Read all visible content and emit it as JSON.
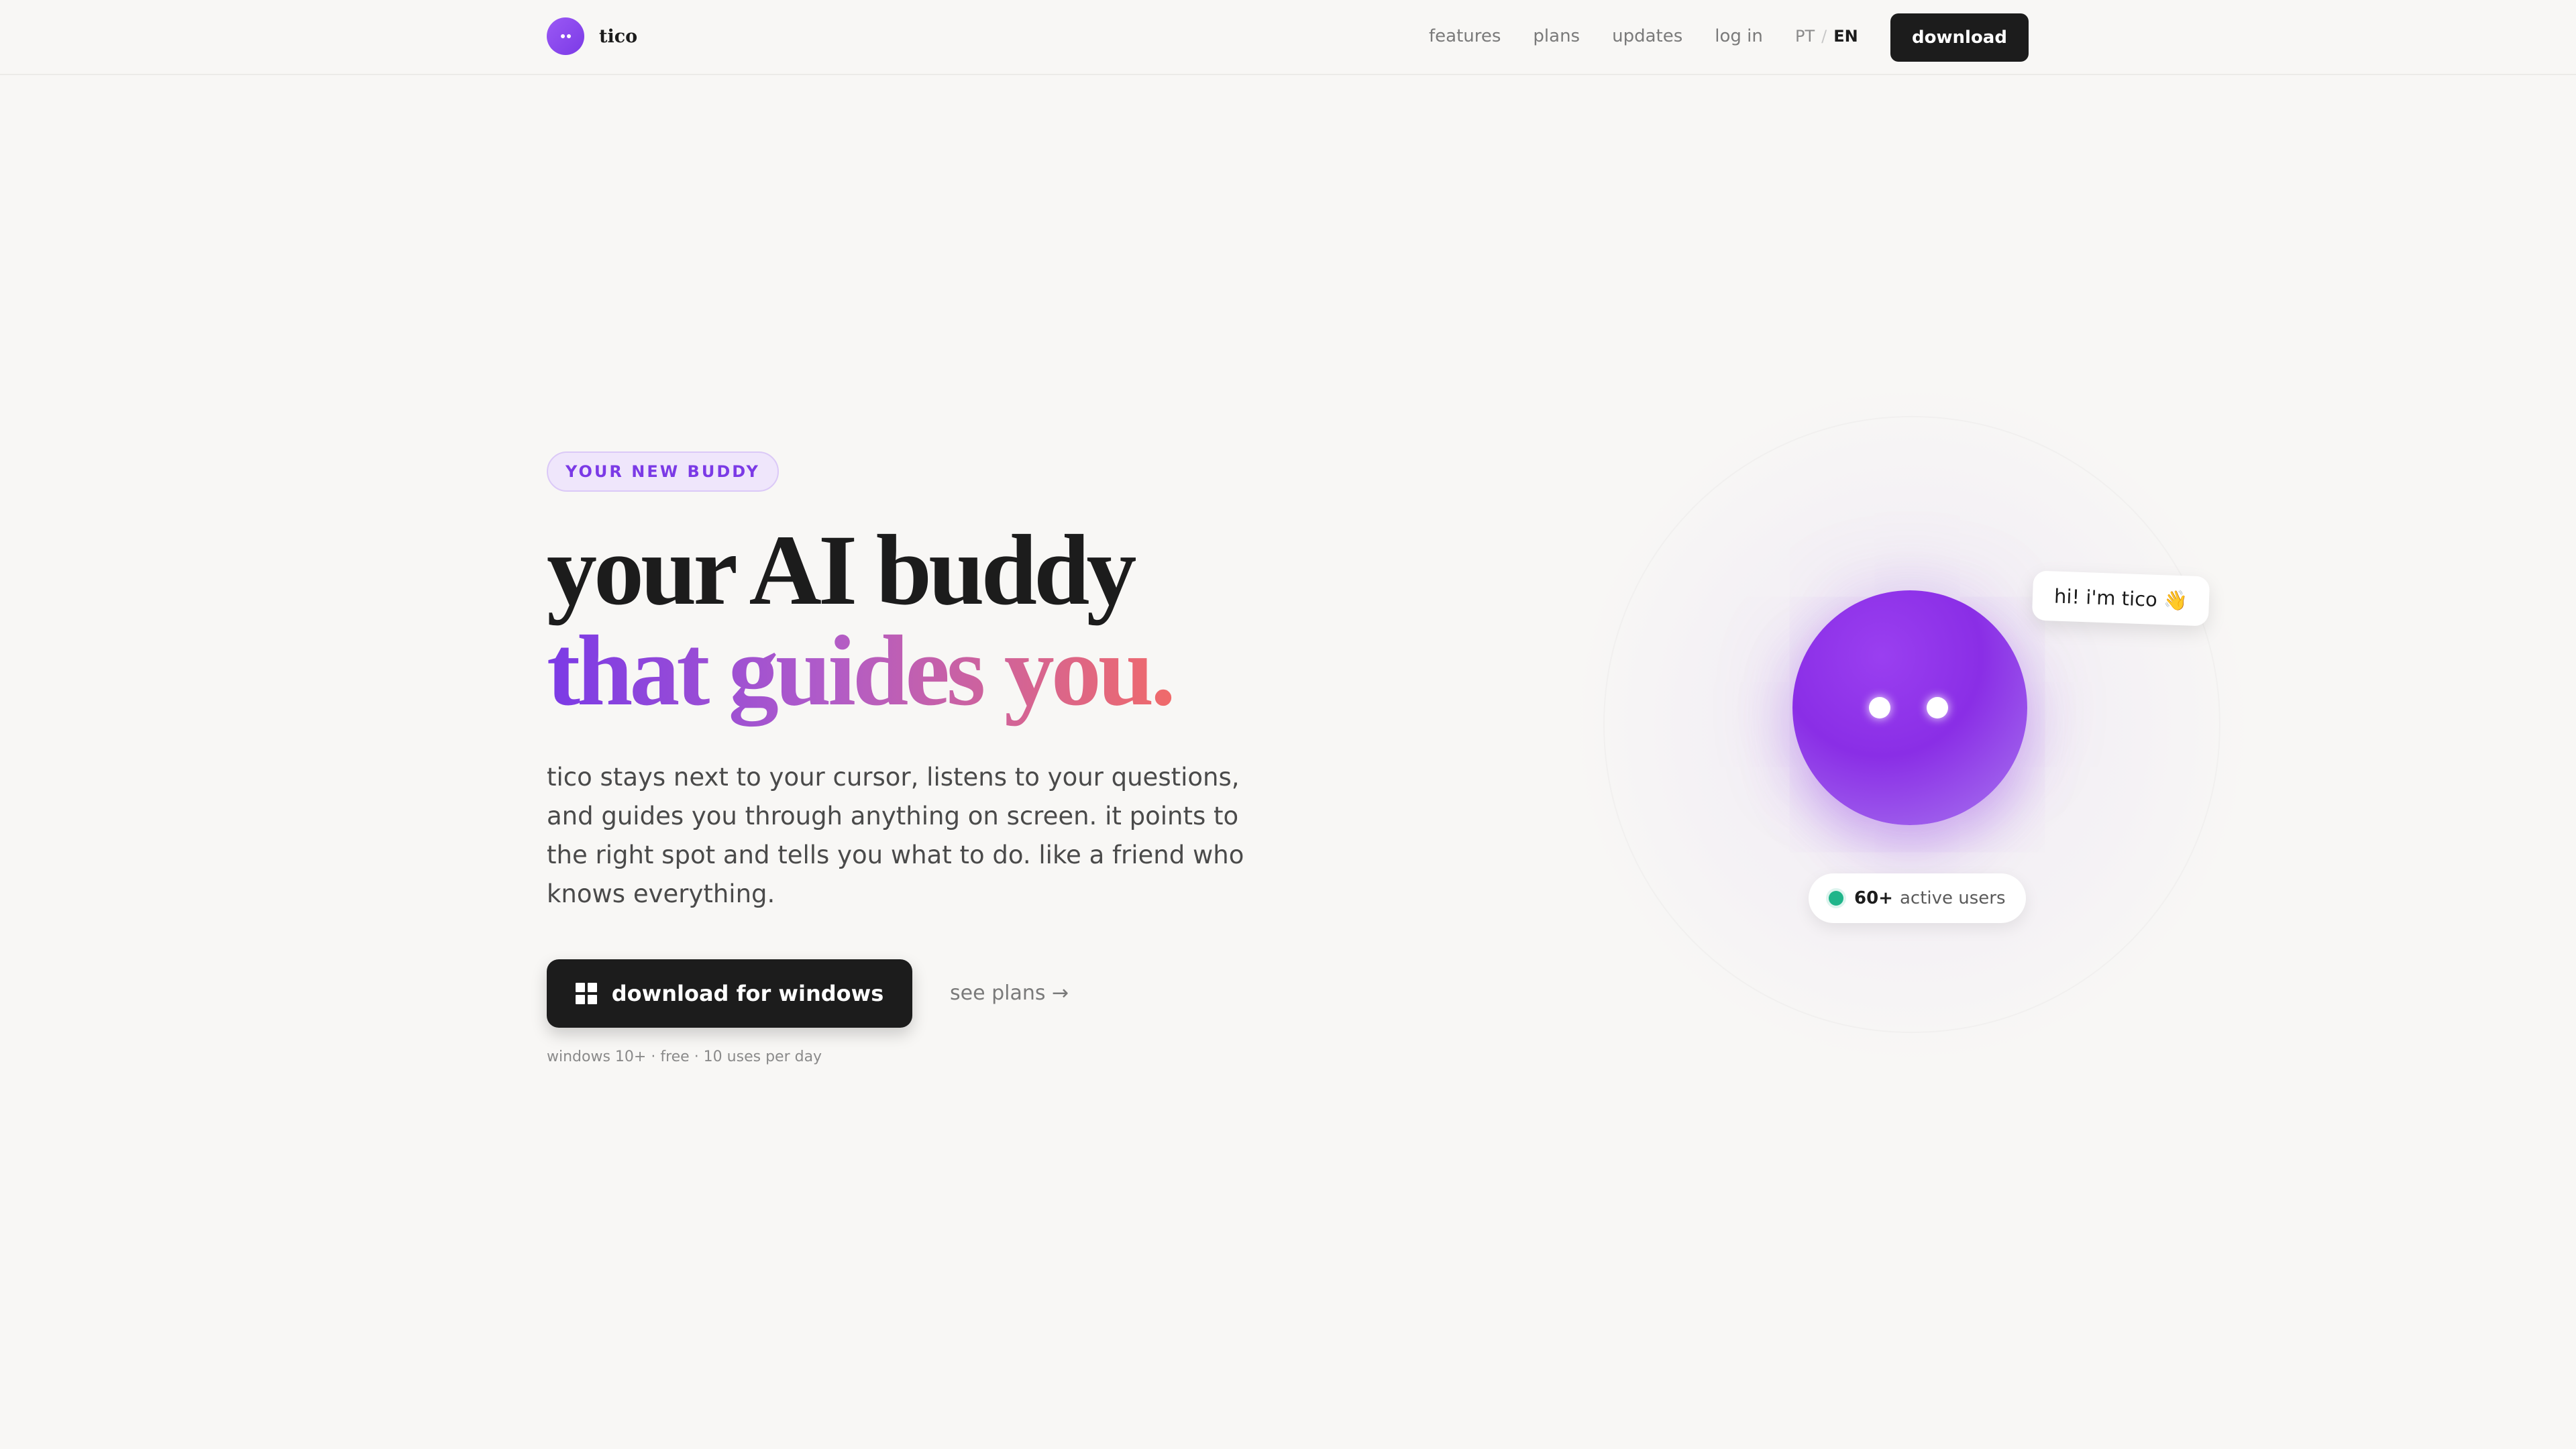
{
  "brand": {
    "name": "tico",
    "logo_icon": "tico-face-icon"
  },
  "nav": {
    "links": [
      "features",
      "plans",
      "updates",
      "log in"
    ],
    "lang_pt": "PT",
    "lang_sep": "/",
    "lang_en": "EN",
    "download_label": "download"
  },
  "hero": {
    "badge": "YOUR NEW BUDDY",
    "headline_line1": "your AI buddy",
    "headline_line2": "that guides you.",
    "subtext": "tico stays next to your cursor, listens to your questions, and guides you through anything on screen. it points to the right spot and tells you what to do. like a friend who knows everything.",
    "cta_label": "download for windows",
    "cta_icon": "windows-icon",
    "see_plans": "see plans →",
    "fine_print": "windows 10+ · free · 10 uses per day"
  },
  "mascot": {
    "bubble": "hi! i'm tico 👋",
    "users_count": "60+",
    "users_label": "active users"
  },
  "colors": {
    "accent": "#7b3ae6",
    "gradient_end": "#f06a6a",
    "dark": "#1c1c1c",
    "background": "#f8f7f5",
    "online": "#1fb58a"
  }
}
